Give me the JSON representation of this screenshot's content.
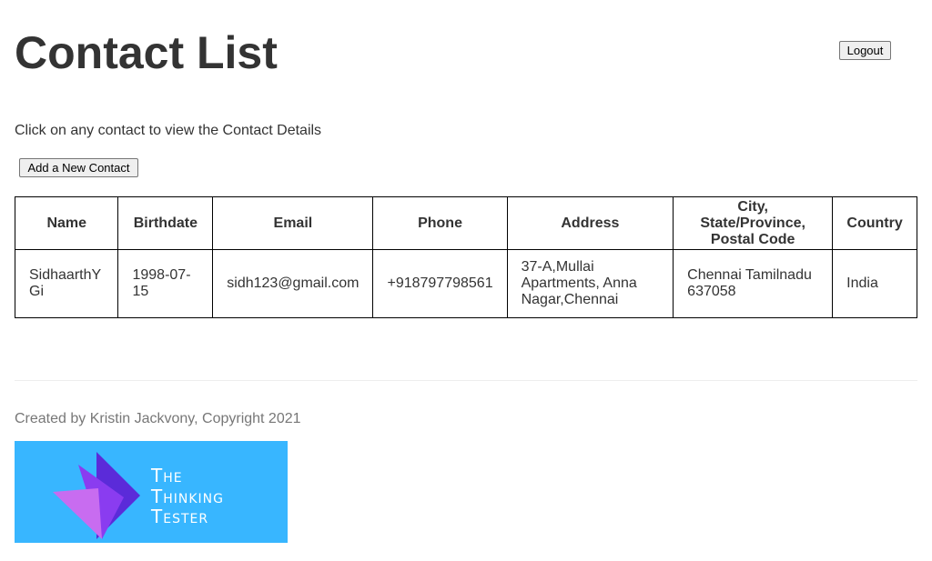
{
  "header": {
    "title": "Contact List",
    "logout_label": "Logout"
  },
  "intro": {
    "text": "Click on any contact to view the Contact Details"
  },
  "actions": {
    "add_contact_label": "Add a New Contact"
  },
  "table": {
    "columns": [
      "Name",
      "Birthdate",
      "Email",
      "Phone",
      "Address",
      "City, State/Province, Postal Code",
      "Country"
    ],
    "rows": [
      {
        "name": "SidhaarthYGi",
        "birthdate": "1998-07-15",
        "email": "sidh123@gmail.com",
        "phone": "+918797798561",
        "address": "37-A,Mullai Apartments, Anna Nagar,Chennai",
        "city_state_postal": "Chennai Tamilnadu 637058",
        "country": "India"
      }
    ]
  },
  "footer": {
    "copyright": "Created by Kristin Jackvony, Copyright 2021",
    "logo_text": "The\nThinking\nTester"
  },
  "colors": {
    "logo_background": "#38b6ff",
    "logo_purple_dark": "#5b2bd9",
    "logo_purple_mid": "#8a3cf0",
    "logo_pink": "#c86cf0",
    "text": "#333333",
    "footer_text": "#777777"
  }
}
